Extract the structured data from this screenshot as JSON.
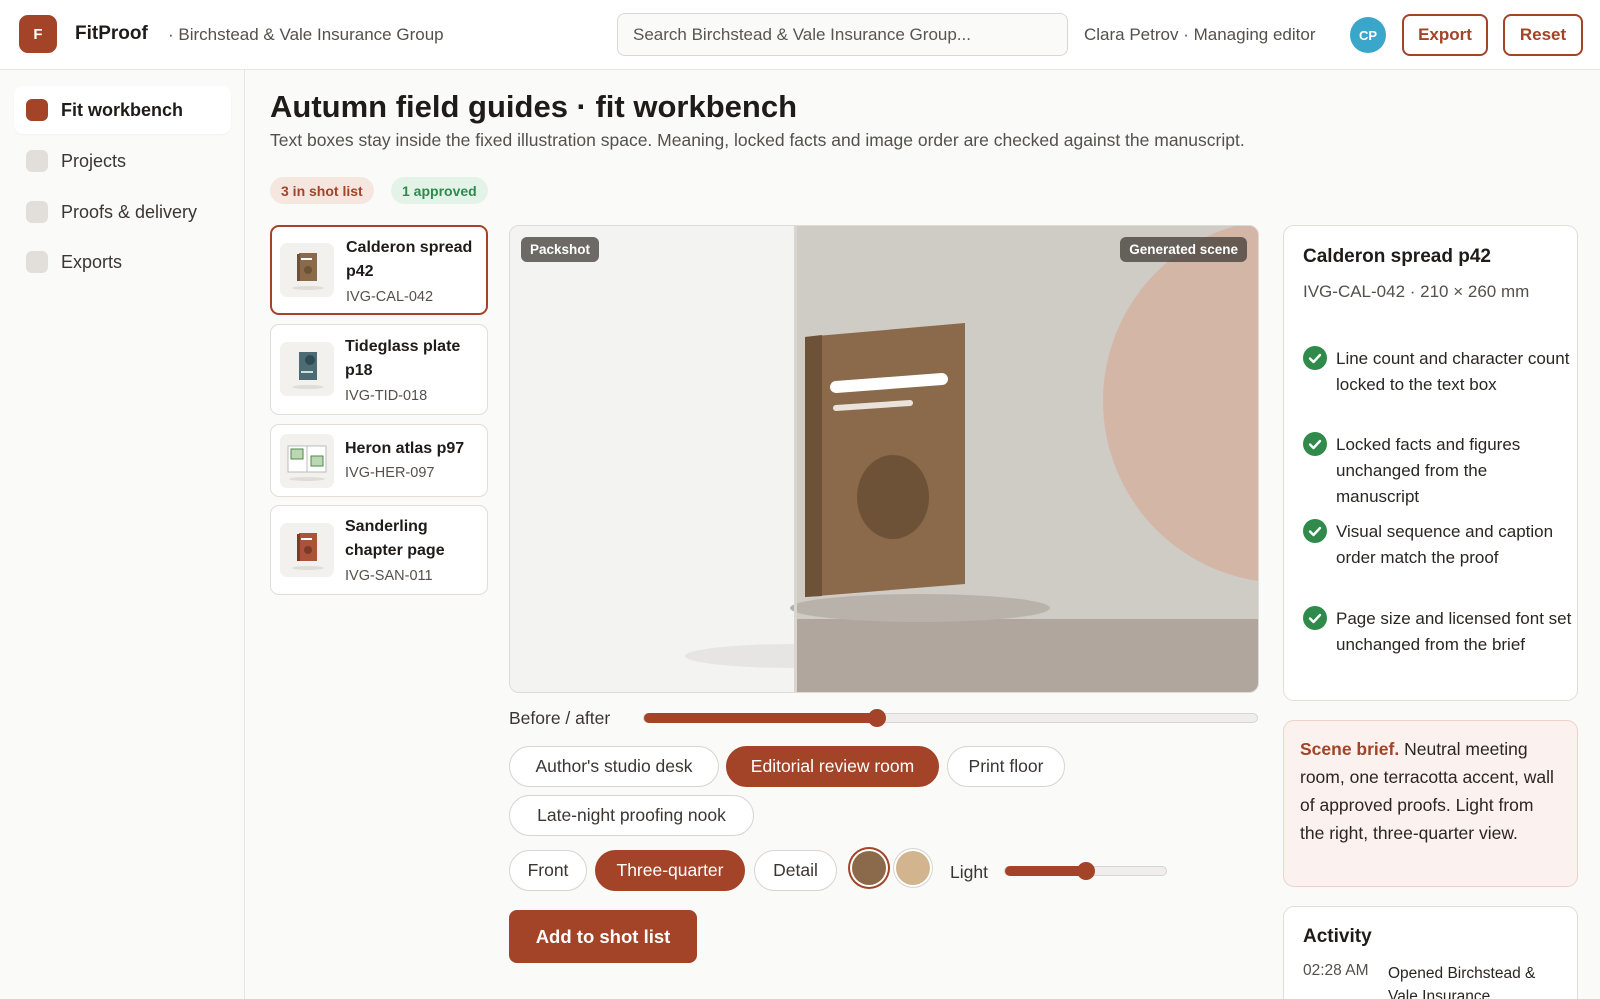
{
  "app": {
    "logo_letter": "F",
    "name": "FitProof",
    "org": "· Birchstead & Vale Insurance Group",
    "search_placeholder": "Search Birchstead & Vale Insurance Group...",
    "user": "Clara Petrov · Managing editor",
    "avatar_initials": "CP",
    "export_label": "Export",
    "reset_label": "Reset"
  },
  "sidebar": {
    "items": [
      {
        "label": "Fit workbench",
        "active": true
      },
      {
        "label": "Projects",
        "active": false
      },
      {
        "label": "Proofs & delivery",
        "active": false
      },
      {
        "label": "Exports",
        "active": false
      }
    ]
  },
  "page": {
    "title": "Autumn field guides · fit workbench",
    "subtitle": "Text boxes stay inside the fixed illustration space. Meaning, locked facts and image order are checked against the manuscript.",
    "badge_shot": "3 in shot list",
    "badge_approved": "1 approved"
  },
  "assets": [
    {
      "name": "Calderon spread p42",
      "code": "IVG-CAL-042",
      "selected": true,
      "thumb": "brown-book-thumbnail"
    },
    {
      "name": "Tideglass plate p18",
      "code": "IVG-TID-018",
      "selected": false,
      "thumb": "teal-plate-thumbnail"
    },
    {
      "name": "Heron atlas p97",
      "code": "IVG-HER-097",
      "selected": false,
      "thumb": "atlas-spread-thumbnail"
    },
    {
      "name": "Sanderling chapter page",
      "code": "IVG-SAN-011",
      "selected": false,
      "thumb": "terracotta-book-thumbnail"
    }
  ],
  "preview": {
    "packshot_label": "Packshot",
    "generated_label": "Generated scene",
    "before_after_label": "Before / after",
    "before_after_value": 0.38
  },
  "scenes": [
    {
      "label": "Author's studio desk",
      "on": false
    },
    {
      "label": "Editorial review room",
      "on": true
    },
    {
      "label": "Print floor",
      "on": false
    },
    {
      "label": "Late-night proofing nook",
      "on": false
    }
  ],
  "angles": [
    {
      "label": "Front",
      "on": false
    },
    {
      "label": "Three-quarter",
      "on": true
    },
    {
      "label": "Detail",
      "on": false
    }
  ],
  "swatches": [
    {
      "color": "#8a6a4a",
      "selected": true
    },
    {
      "color": "#d2b48e",
      "selected": false
    }
  ],
  "light": {
    "label": "Light",
    "value": 0.5
  },
  "add_label": "Add to shot list",
  "details": {
    "title": "Calderon spread p42",
    "meta": "IVG-CAL-042 · 210 × 260 mm",
    "checks": [
      "Line count and character count locked to the text box",
      "Locked facts and figures unchanged from the manuscript",
      "Visual sequence and caption order match the proof",
      "Page size and licensed font set unchanged from the brief"
    ]
  },
  "brief": {
    "lead": "Scene brief.",
    "text": "Neutral meeting room, one terracotta accent, wall of approved proofs. Light from the right, three-quarter view."
  },
  "activity": {
    "title": "Activity",
    "entries": [
      {
        "time": "02:28 AM",
        "text": "Opened Birchstead & Vale Insurance"
      }
    ]
  },
  "colors": {
    "accent": "#a34327",
    "success": "#2f8a4b",
    "avatar": "#3aa6c9"
  }
}
